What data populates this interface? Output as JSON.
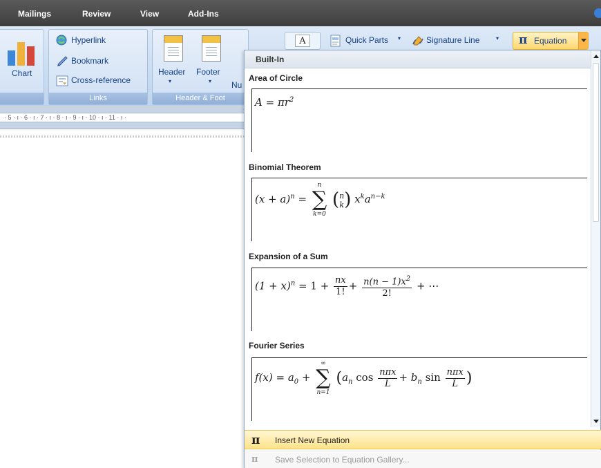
{
  "tabs": [
    "Mailings",
    "Review",
    "View",
    "Add-Ins"
  ],
  "ribbon": {
    "chart_label": "Chart",
    "links": {
      "hyperlink": "Hyperlink",
      "bookmark": "Bookmark",
      "cross_reference": "Cross-reference",
      "group_label": "Links"
    },
    "header_footer": {
      "header": "Header",
      "footer": "Footer",
      "page_number_partial": "Nu",
      "group_label": "Header & Foot"
    },
    "text_group": {
      "text_box_glyph": "A",
      "quick_parts": "Quick Parts",
      "signature_line": "Signature Line"
    },
    "equation": {
      "glyph": "π",
      "label": "Equation"
    }
  },
  "ruler": {
    "marks": "· 5 · ı · 6 · ı · 7 · ı · 8 · ı · 9 · ı · 10 · ı · 11 · ı ·"
  },
  "dropdown": {
    "header": "Built-In",
    "items": [
      {
        "title": "Area of Circle"
      },
      {
        "title": "Binomial Theorem"
      },
      {
        "title": "Expansion of a Sum"
      },
      {
        "title": "Fourier Series"
      }
    ],
    "insert_new": "Insert New Equation",
    "insert_glyph": "π",
    "save_selection": "Save Selection to Equation Gallery...",
    "save_glyph": "π"
  },
  "colors": {
    "tab_bar": "#4a4a4a",
    "ribbon": "#c7daf1",
    "highlight": "#ffe38a"
  }
}
